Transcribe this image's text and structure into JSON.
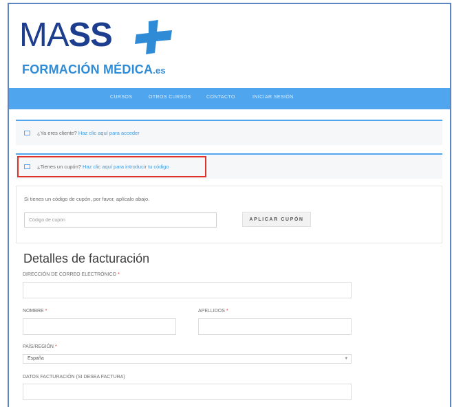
{
  "logo": {
    "wordmark_thin": "MA",
    "wordmark_bold": "SS",
    "subtitle": "FORMACIÓN MÉDICA",
    "subtitle_suffix": ".es",
    "icon": "plus-icon",
    "colors": {
      "dark": "#1d3d8f",
      "accent": "#2f8bd6"
    }
  },
  "nav": {
    "items": [
      {
        "label": "CURSOS"
      },
      {
        "label": "OTROS CURSOS"
      },
      {
        "label": "CONTACTO"
      },
      {
        "label": "INICIAR SESIÓN"
      }
    ],
    "color": "#4fa6ef"
  },
  "notices": {
    "returning_customer": {
      "text": "¿Ya eres cliente?",
      "link": "Haz clic aquí para acceder",
      "icon": "window-icon"
    },
    "coupon": {
      "text": "¿Tienes un cupón?",
      "link": "Haz clic aquí para introducir tu código",
      "icon": "window-icon"
    }
  },
  "coupon_form": {
    "info": "Si tienes un código de cupón, por favor, aplícalo abajo.",
    "placeholder": "Código de cupón",
    "button": "APLICAR CUPÓN"
  },
  "billing": {
    "title": "Detalles de facturación",
    "email_label": "DIRECCIÓN DE CORREO ELECTRÓNICO",
    "first_name_label": "NOMBRE",
    "last_name_label": "APELLIDOS",
    "country_label": "PAÍS/REGIÓN",
    "country_value": "España",
    "invoice_label": "DATOS FACTURACIÓN (SI DESEA FACTURA)",
    "required_mark": "*"
  },
  "highlight_color": "#e0322a"
}
